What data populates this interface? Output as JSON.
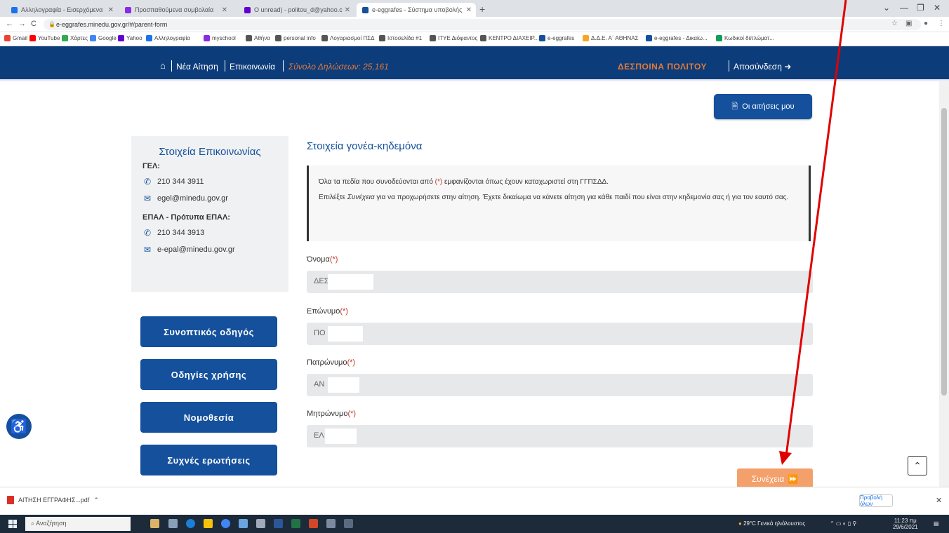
{
  "browser": {
    "tabs": [
      {
        "label": "Αλληλογραφία - Εισερχόμενα",
        "color": "#1a73e8"
      },
      {
        "label": "Προσπαθούμενα συμβολαία",
        "color": "#8a2be2"
      },
      {
        "label": "Ο unread) - politou_d@yahoo.c",
        "color": "#6001d2"
      },
      {
        "label": "e-eggrafes - Σύστημα υποβολής",
        "color": "#14509c"
      }
    ],
    "new_tab": "+",
    "url": "e-eggrafes.minedu.gov.gr/#/parent-form",
    "bookmarks": [
      {
        "label": "Gmail",
        "color": "#ea4335"
      },
      {
        "label": "YouTube",
        "color": "#ff0000"
      },
      {
        "label": "Χάρτες",
        "color": "#34a853"
      },
      {
        "label": "Google",
        "color": "#4285f4"
      },
      {
        "label": "Yahoo",
        "color": "#6001d2"
      },
      {
        "label": "Αλληλογραφία",
        "color": "#1a73e8"
      },
      {
        "label": "myschool",
        "color": "#8a2be2"
      },
      {
        "label": "Αθήνα",
        "color": "#555555"
      },
      {
        "label": "personal info",
        "color": "#555555"
      },
      {
        "label": "Λογαριασμοί ΠΣΔ",
        "color": "#555555"
      },
      {
        "label": "Ιστοσελίδα #1",
        "color": "#555555"
      },
      {
        "label": "ΙΤΥΕ Διόφαντος",
        "color": "#555555"
      },
      {
        "label": "ΚΕΝΤΡΟ ΔΙΑΧΕΙΡ...",
        "color": "#555555"
      },
      {
        "label": "e-eggrafes",
        "color": "#14509c"
      },
      {
        "label": "Δ.Δ.Ε. Α΄ ΑΘΗΝΑΣ",
        "color": "#f5a623"
      },
      {
        "label": "e-eggrafes - Δικαίω...",
        "color": "#14509c"
      },
      {
        "label": "Κωδικοί διπλώματ...",
        "color": "#0f9d58"
      }
    ]
  },
  "header": {
    "new_application": "Νέα Αίτηση",
    "contact": "Επικοινωνία",
    "total": "Σύνολο Δηλώσεων: 25,161",
    "user": "ΔΕΣΠΟΙΝΑ ΠΟΛΙΤΟΥ",
    "logout": "Αποσύνδεση"
  },
  "my_applications": "Οι αιτήσεις μου",
  "contact_card": {
    "title": "Στοιχεία Επικοινωνίας",
    "gel_label": "ΓΕΛ:",
    "gel_phone": "210 344 3911",
    "gel_email": "egel@minedu.gov.gr",
    "epal_label": "ΕΠΑΛ - Πρότυπα ΕΠΑΛ:",
    "epal_phone": "210 344 3913",
    "epal_email": "e-epal@minedu.gov.gr"
  },
  "side_buttons": [
    "Συνοπτικός οδηγός",
    "Οδηγίες χρήσης",
    "Νομοθεσία",
    "Συχνές ερωτήσεις"
  ],
  "form": {
    "title": "Στοιχεία γονέα-κηδεμόνα",
    "notice_1_pre": "Όλα τα πεδία που συνοδεύονται από ",
    "notice_1_mark": "(*)",
    "notice_1_post": " εμφανίζονται όπως έχουν καταχωριστεί στη ΓΓΠΣΔΔ.",
    "notice_2_pre": "Επιλέξτε ",
    "notice_2_em": "Συνέχεια",
    "notice_2_post": " για να προχωρήσετε στην αίτηση. Έχετε δικαίωμα να κάνετε αίτηση για κάθε παιδί που είναι στην κηδεμονία σας ή για τον εαυτό σας.",
    "required_mark": "(*)",
    "fields": [
      {
        "label": "Όνομα",
        "value": "ΔΕΣ"
      },
      {
        "label": "Επώνυμο",
        "value": "ΠΟ"
      },
      {
        "label": "Πατρώνυμο",
        "value": "ΑΝ"
      },
      {
        "label": "Μητρώνυμο",
        "value": "ΕΛ"
      }
    ],
    "continue_label": "Συνέχεια"
  },
  "downloads": {
    "file": "ΑΙΤΗΣΗ ΕΓΓΡΑΦΗΣ...pdf",
    "show_all": "Προβολή όλων"
  },
  "taskbar": {
    "search": "Αναζήτηση",
    "weather": "29°C Γενικά ηλιόλουστος",
    "time": "11:23 πμ",
    "date": "29/6/2021"
  },
  "colors": {
    "brand": "#14509c",
    "header": "#0d3c7a",
    "accent": "#e07a3a",
    "annotation": "#e00000"
  }
}
